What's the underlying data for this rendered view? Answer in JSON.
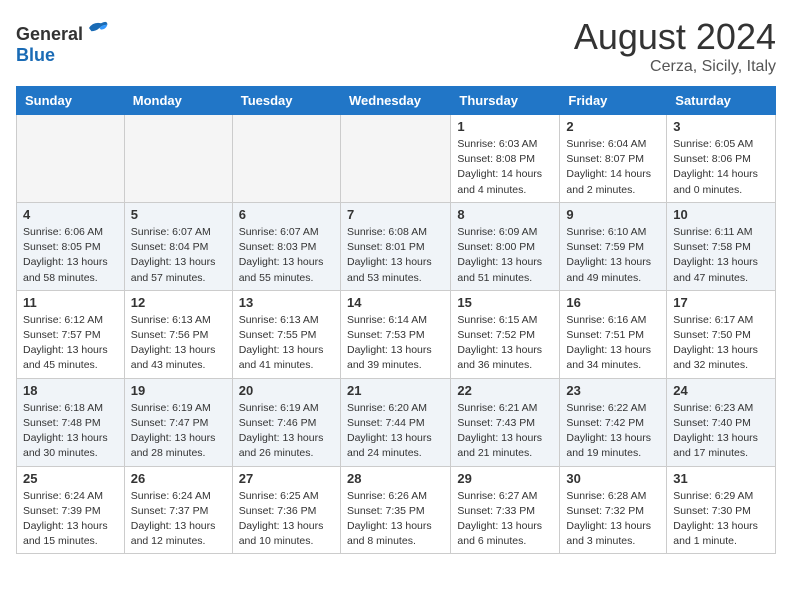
{
  "header": {
    "logo_general": "General",
    "logo_blue": "Blue",
    "month_year": "August 2024",
    "location": "Cerza, Sicily, Italy"
  },
  "weekdays": [
    "Sunday",
    "Monday",
    "Tuesday",
    "Wednesday",
    "Thursday",
    "Friday",
    "Saturday"
  ],
  "rows": [
    {
      "cells": [
        {
          "day": "",
          "empty": true
        },
        {
          "day": "",
          "empty": true
        },
        {
          "day": "",
          "empty": true
        },
        {
          "day": "",
          "empty": true
        },
        {
          "day": "1",
          "sunrise": "6:03 AM",
          "sunset": "8:08 PM",
          "daylight": "14 hours and 4 minutes."
        },
        {
          "day": "2",
          "sunrise": "6:04 AM",
          "sunset": "8:07 PM",
          "daylight": "14 hours and 2 minutes."
        },
        {
          "day": "3",
          "sunrise": "6:05 AM",
          "sunset": "8:06 PM",
          "daylight": "14 hours and 0 minutes."
        }
      ]
    },
    {
      "cells": [
        {
          "day": "4",
          "sunrise": "6:06 AM",
          "sunset": "8:05 PM",
          "daylight": "13 hours and 58 minutes."
        },
        {
          "day": "5",
          "sunrise": "6:07 AM",
          "sunset": "8:04 PM",
          "daylight": "13 hours and 57 minutes."
        },
        {
          "day": "6",
          "sunrise": "6:07 AM",
          "sunset": "8:03 PM",
          "daylight": "13 hours and 55 minutes."
        },
        {
          "day": "7",
          "sunrise": "6:08 AM",
          "sunset": "8:01 PM",
          "daylight": "13 hours and 53 minutes."
        },
        {
          "day": "8",
          "sunrise": "6:09 AM",
          "sunset": "8:00 PM",
          "daylight": "13 hours and 51 minutes."
        },
        {
          "day": "9",
          "sunrise": "6:10 AM",
          "sunset": "7:59 PM",
          "daylight": "13 hours and 49 minutes."
        },
        {
          "day": "10",
          "sunrise": "6:11 AM",
          "sunset": "7:58 PM",
          "daylight": "13 hours and 47 minutes."
        }
      ]
    },
    {
      "cells": [
        {
          "day": "11",
          "sunrise": "6:12 AM",
          "sunset": "7:57 PM",
          "daylight": "13 hours and 45 minutes."
        },
        {
          "day": "12",
          "sunrise": "6:13 AM",
          "sunset": "7:56 PM",
          "daylight": "13 hours and 43 minutes."
        },
        {
          "day": "13",
          "sunrise": "6:13 AM",
          "sunset": "7:55 PM",
          "daylight": "13 hours and 41 minutes."
        },
        {
          "day": "14",
          "sunrise": "6:14 AM",
          "sunset": "7:53 PM",
          "daylight": "13 hours and 39 minutes."
        },
        {
          "day": "15",
          "sunrise": "6:15 AM",
          "sunset": "7:52 PM",
          "daylight": "13 hours and 36 minutes."
        },
        {
          "day": "16",
          "sunrise": "6:16 AM",
          "sunset": "7:51 PM",
          "daylight": "13 hours and 34 minutes."
        },
        {
          "day": "17",
          "sunrise": "6:17 AM",
          "sunset": "7:50 PM",
          "daylight": "13 hours and 32 minutes."
        }
      ]
    },
    {
      "cells": [
        {
          "day": "18",
          "sunrise": "6:18 AM",
          "sunset": "7:48 PM",
          "daylight": "13 hours and 30 minutes."
        },
        {
          "day": "19",
          "sunrise": "6:19 AM",
          "sunset": "7:47 PM",
          "daylight": "13 hours and 28 minutes."
        },
        {
          "day": "20",
          "sunrise": "6:19 AM",
          "sunset": "7:46 PM",
          "daylight": "13 hours and 26 minutes."
        },
        {
          "day": "21",
          "sunrise": "6:20 AM",
          "sunset": "7:44 PM",
          "daylight": "13 hours and 24 minutes."
        },
        {
          "day": "22",
          "sunrise": "6:21 AM",
          "sunset": "7:43 PM",
          "daylight": "13 hours and 21 minutes."
        },
        {
          "day": "23",
          "sunrise": "6:22 AM",
          "sunset": "7:42 PM",
          "daylight": "13 hours and 19 minutes."
        },
        {
          "day": "24",
          "sunrise": "6:23 AM",
          "sunset": "7:40 PM",
          "daylight": "13 hours and 17 minutes."
        }
      ]
    },
    {
      "cells": [
        {
          "day": "25",
          "sunrise": "6:24 AM",
          "sunset": "7:39 PM",
          "daylight": "13 hours and 15 minutes."
        },
        {
          "day": "26",
          "sunrise": "6:24 AM",
          "sunset": "7:37 PM",
          "daylight": "13 hours and 12 minutes."
        },
        {
          "day": "27",
          "sunrise": "6:25 AM",
          "sunset": "7:36 PM",
          "daylight": "13 hours and 10 minutes."
        },
        {
          "day": "28",
          "sunrise": "6:26 AM",
          "sunset": "7:35 PM",
          "daylight": "13 hours and 8 minutes."
        },
        {
          "day": "29",
          "sunrise": "6:27 AM",
          "sunset": "7:33 PM",
          "daylight": "13 hours and 6 minutes."
        },
        {
          "day": "30",
          "sunrise": "6:28 AM",
          "sunset": "7:32 PM",
          "daylight": "13 hours and 3 minutes."
        },
        {
          "day": "31",
          "sunrise": "6:29 AM",
          "sunset": "7:30 PM",
          "daylight": "13 hours and 1 minute."
        }
      ]
    }
  ]
}
